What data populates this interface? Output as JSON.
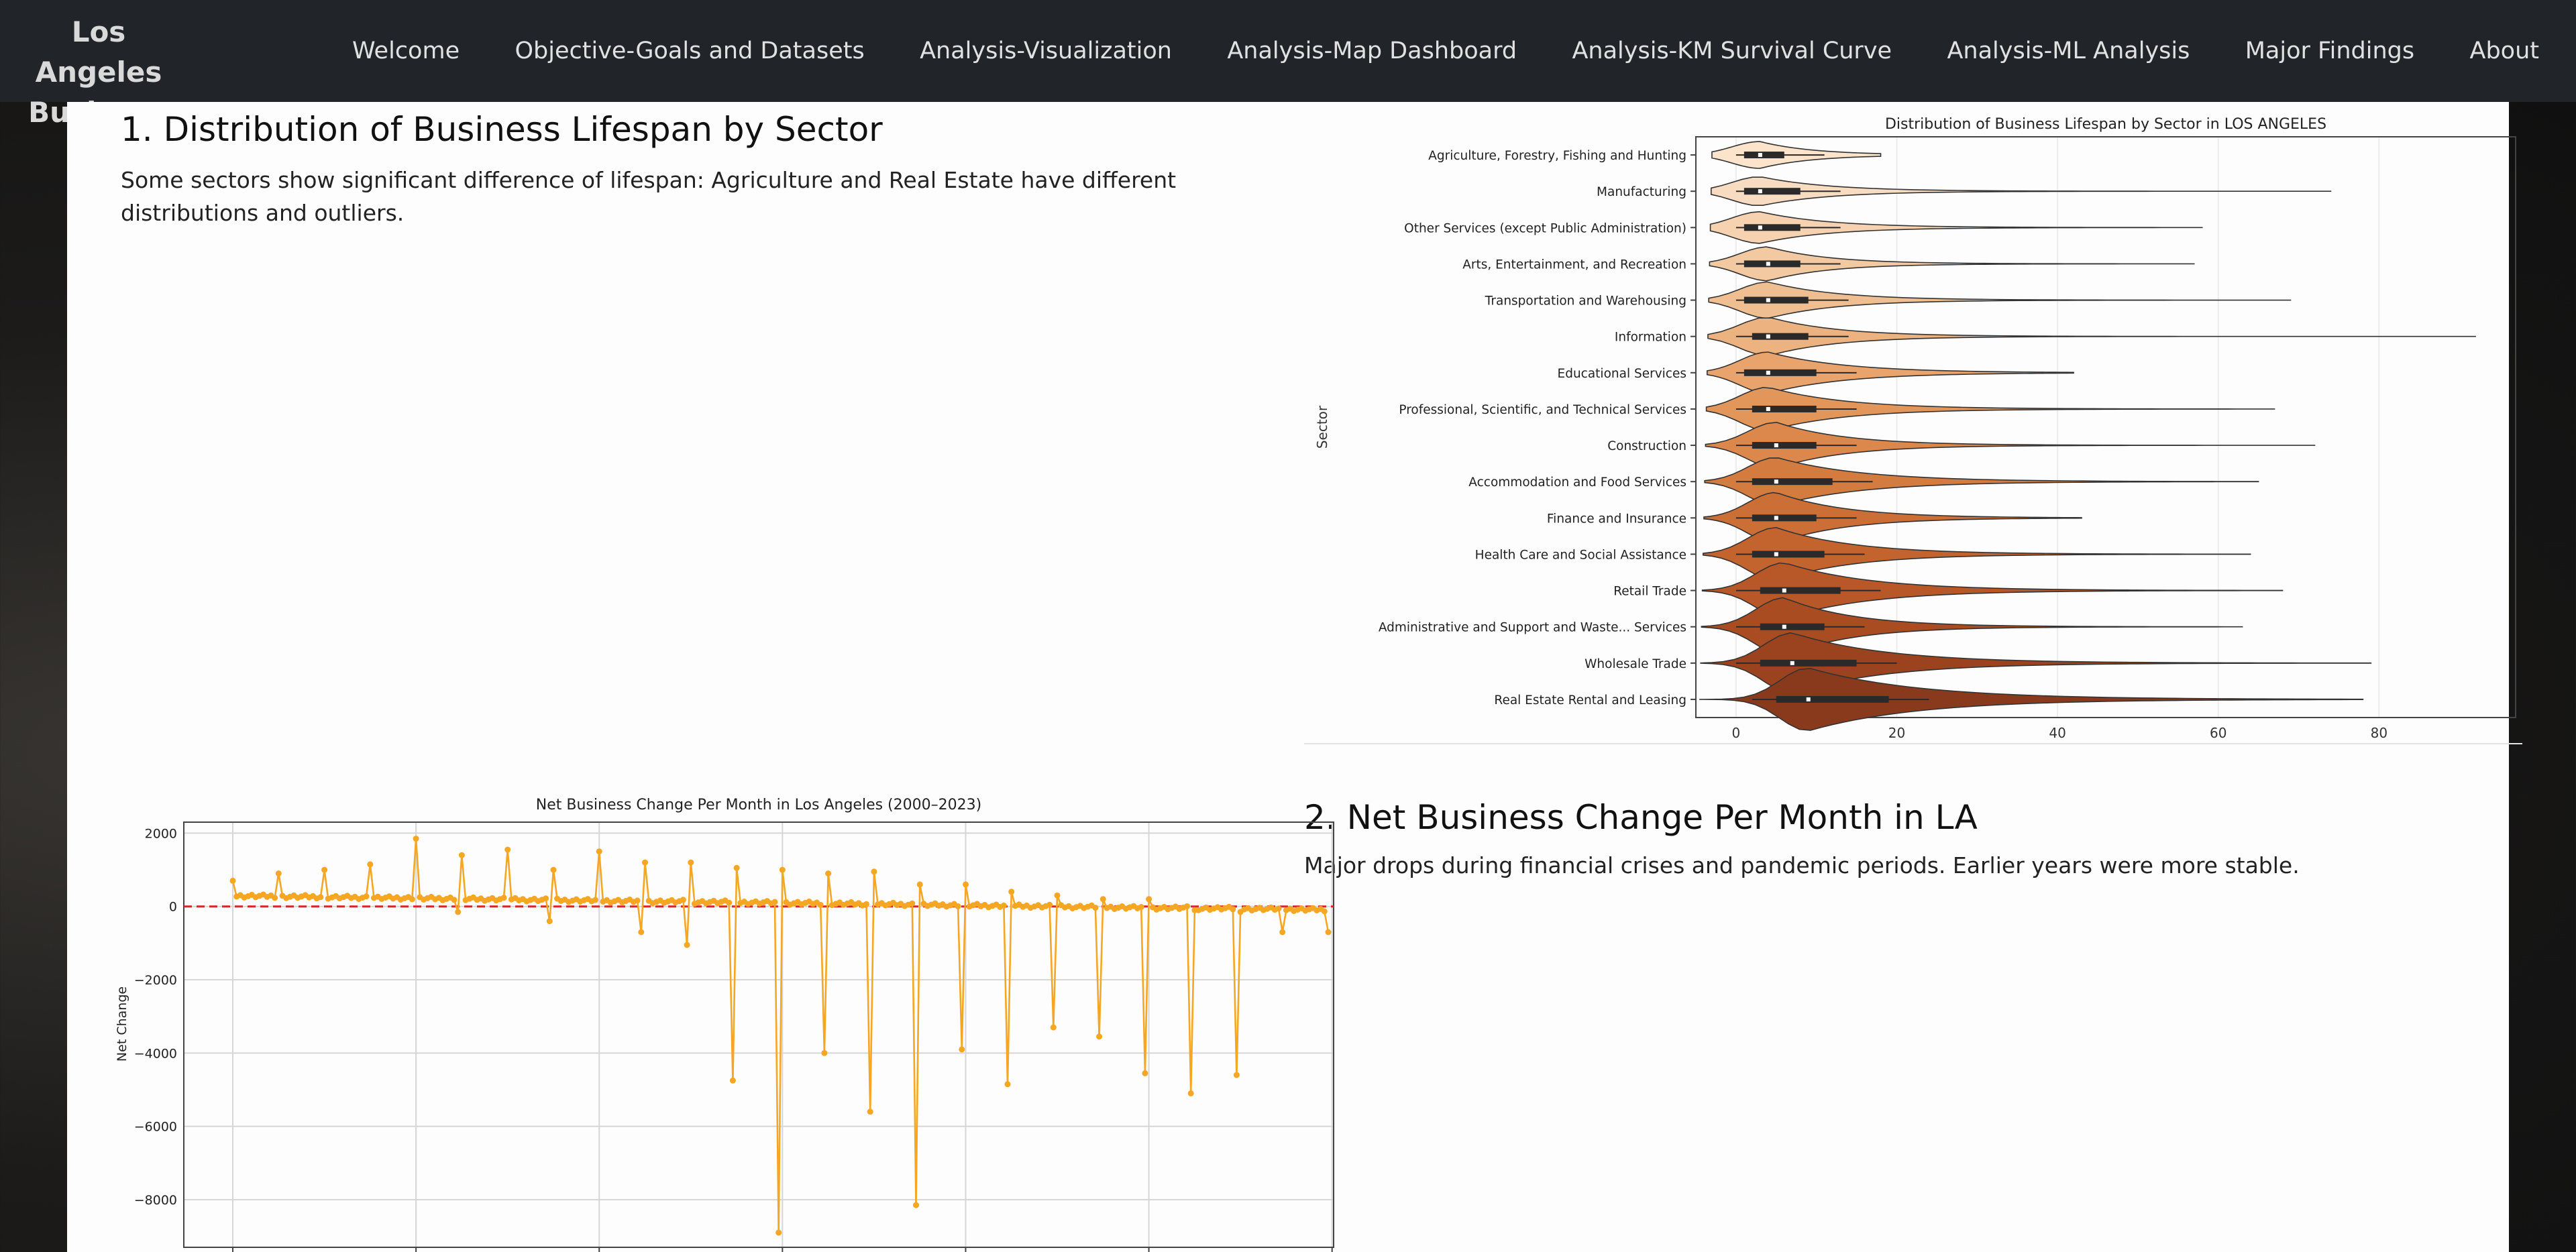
{
  "brand": "Los Angeles Business",
  "nav": [
    "Welcome",
    "Objective-Goals and Datasets",
    "Analysis-Visualization",
    "Analysis-Map Dashboard",
    "Analysis-KM Survival Curve",
    "Analysis-ML Analysis",
    "Major Findings",
    "About"
  ],
  "section1": {
    "title": "1. Distribution of Business Lifespan by Sector",
    "desc": "Some sectors show significant difference of lifespan: Agriculture and Real Estate have different distributions and outliers."
  },
  "section2": {
    "title": "2. Net Business Change Per Month in LA",
    "desc": "Major drops during financial crises and pandemic periods. Earlier years were more stable."
  },
  "colors": {
    "nav_bg": "#212529",
    "line": "#f5a623",
    "zero_line": "#d62728"
  },
  "chart_data": [
    {
      "type": "violin",
      "title": "Distribution of Business Lifespan by Sector in LOS ANGELES",
      "ylabel": "Sector",
      "xlim": [
        -5,
        97
      ],
      "xticks": [
        0,
        20,
        40,
        60,
        80
      ],
      "categories": [
        {
          "name": "Agriculture, Forestry, Fishing and Hunting",
          "median": 3,
          "q1": 1,
          "q3": 6,
          "max": 18,
          "color": "#fbe3cc"
        },
        {
          "name": "Manufacturing",
          "median": 3,
          "q1": 1,
          "q3": 8,
          "max": 74,
          "color": "#f8dcc1"
        },
        {
          "name": "Other Services (except Public Administration)",
          "median": 3,
          "q1": 1,
          "q3": 8,
          "max": 58,
          "color": "#f6d2b1"
        },
        {
          "name": "Arts, Entertainment, and Recreation",
          "median": 4,
          "q1": 1,
          "q3": 8,
          "max": 57,
          "color": "#f3c9a2"
        },
        {
          "name": "Transportation and Warehousing",
          "median": 4,
          "q1": 1,
          "q3": 9,
          "max": 69,
          "color": "#f0bf91"
        },
        {
          "name": "Information",
          "median": 4,
          "q1": 2,
          "q3": 9,
          "max": 92,
          "color": "#ecb27f"
        },
        {
          "name": "Educational Services",
          "median": 4,
          "q1": 1,
          "q3": 10,
          "max": 42,
          "color": "#e8a46c"
        },
        {
          "name": "Professional, Scientific, and Technical Services",
          "median": 4,
          "q1": 2,
          "q3": 10,
          "max": 67,
          "color": "#e3965a"
        },
        {
          "name": "Construction",
          "median": 5,
          "q1": 2,
          "q3": 10,
          "max": 72,
          "color": "#dc884c"
        },
        {
          "name": "Accommodation and Food Services",
          "median": 5,
          "q1": 2,
          "q3": 12,
          "max": 65,
          "color": "#d47b40"
        },
        {
          "name": "Finance and Insurance",
          "median": 5,
          "q1": 2,
          "q3": 10,
          "max": 43,
          "color": "#cc6f36"
        },
        {
          "name": "Health Care and Social Assistance",
          "median": 5,
          "q1": 2,
          "q3": 11,
          "max": 64,
          "color": "#c3632d"
        },
        {
          "name": "Retail Trade",
          "median": 6,
          "q1": 3,
          "q3": 13,
          "max": 68,
          "color": "#b85727"
        },
        {
          "name": "Administrative and Support and Waste... Services",
          "median": 6,
          "q1": 3,
          "q3": 11,
          "max": 63,
          "color": "#aa4c22"
        },
        {
          "name": "Wholesale Trade",
          "median": 7,
          "q1": 3,
          "q3": 15,
          "max": 79,
          "color": "#9b431f"
        },
        {
          "name": "Real Estate Rental and Leasing",
          "median": 9,
          "q1": 5,
          "q3": 19,
          "max": 78,
          "color": "#8a3a1c"
        }
      ]
    },
    {
      "type": "line",
      "title": "Net Business Change Per Month in Los Angeles (2000–2023)",
      "ylabel": "Net Change",
      "ylim": [
        -9300,
        2300
      ],
      "yticks": [
        2000,
        0,
        -2000,
        -4000,
        -6000,
        -8000
      ],
      "x_start_year": 2000,
      "months": 288,
      "annual_spikes": [
        700,
        900,
        1000,
        1150,
        1850,
        1400,
        1550,
        1000,
        1500,
        1200,
        1200,
        1050,
        1000,
        900,
        950,
        600,
        600,
        400,
        300,
        200,
        200,
        -100,
        -150,
        -100
      ],
      "drops": [
        {
          "year": 2004,
          "value": -150
        },
        {
          "year": 2006,
          "value": -400
        },
        {
          "year": 2008,
          "value": -700
        },
        {
          "year": 2009,
          "value": -1050
        },
        {
          "year": 2010,
          "value": -4750
        },
        {
          "year": 2011,
          "value": -8900
        },
        {
          "year": 2012,
          "value": -4000
        },
        {
          "year": 2013,
          "value": -5600
        },
        {
          "year": 2014,
          "value": -8150
        },
        {
          "year": 2015,
          "value": -3900
        },
        {
          "year": 2016,
          "value": -4850
        },
        {
          "year": 2017,
          "value": -3300
        },
        {
          "year": 2018,
          "value": -3550
        },
        {
          "year": 2019,
          "value": -4550
        },
        {
          "year": 2020,
          "value": -5100
        },
        {
          "year": 2021,
          "value": -4600
        },
        {
          "year": 2022,
          "value": -700
        },
        {
          "year": 2023,
          "value": -700
        }
      ]
    }
  ]
}
